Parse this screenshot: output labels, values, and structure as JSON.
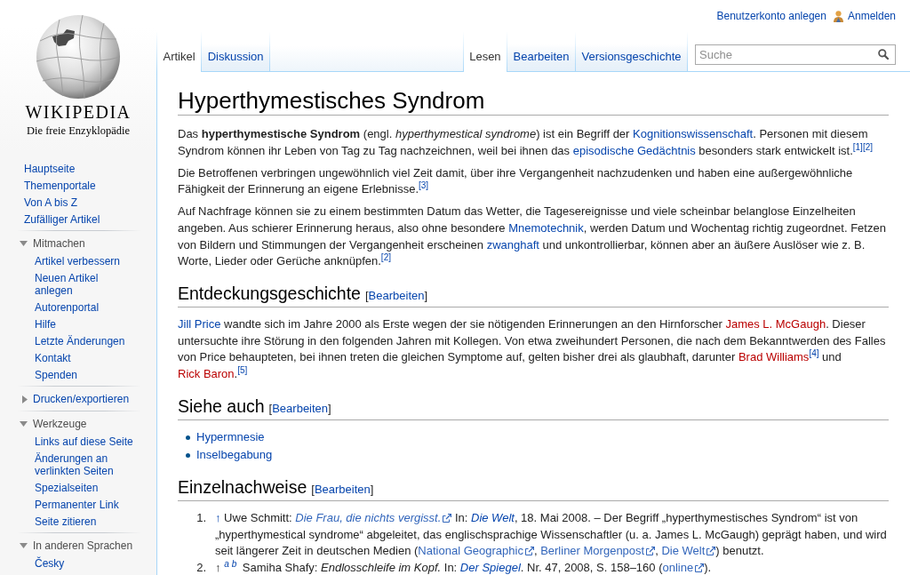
{
  "logo": {
    "wordmark": "WIKIPEDIA",
    "tagline": "Die freie Enzyklopädie"
  },
  "sidebar": {
    "main_links": [
      "Hauptseite",
      "Themenportale",
      "Von A bis Z",
      "Zufälliger Artikel"
    ],
    "portals": [
      {
        "title": "Mitmachen",
        "expanded": true,
        "items": [
          "Artikel verbessern",
          "Neuen Artikel anlegen",
          "Autorenportal",
          "Hilfe",
          "Letzte Änderungen",
          "Kontakt",
          "Spenden"
        ]
      },
      {
        "title": "Drucken/exportieren",
        "expanded": false
      },
      {
        "title": "Werkzeuge",
        "expanded": true,
        "items": [
          "Links auf diese Seite",
          "Änderungen an verlinkten Seiten",
          "Spezialseiten",
          "Permanenter Link",
          "Seite zitieren"
        ]
      },
      {
        "title": "In anderen Sprachen",
        "expanded": true,
        "items": [
          "Česky"
        ]
      }
    ]
  },
  "personal_links": {
    "create_account": "Benutzerkonto anlegen",
    "login": "Anmelden"
  },
  "namespace_tabs": [
    {
      "label": "Artikel",
      "selected": true
    },
    {
      "label": "Diskussion",
      "selected": false
    }
  ],
  "view_tabs": [
    {
      "label": "Lesen",
      "selected": true
    },
    {
      "label": "Bearbeiten",
      "selected": false
    },
    {
      "label": "Versionsgeschichte",
      "selected": false
    }
  ],
  "search": {
    "placeholder": "Suche"
  },
  "article": {
    "title": "Hyperthymestisches Syndrom",
    "intro": [
      {
        "segments": [
          {
            "kind": "text",
            "text": "Das **hyperthymestische Syndrom** (engl. *hyperthymestical syndrome*) ist ein Begriff der "
          },
          {
            "kind": "link",
            "text": "Kognitionswissenschaft"
          },
          {
            "kind": "text",
            "text": ". Personen mit diesem Syndrom können ihr Leben von Tag zu Tag nachzeichnen, weil bei ihnen das "
          },
          {
            "kind": "link",
            "text": "episodische Gedächtnis"
          },
          {
            "kind": "text",
            "text": " besonders stark entwickelt ist."
          },
          {
            "kind": "ref",
            "text": "[1]"
          },
          {
            "kind": "ref",
            "text": "[2]"
          }
        ]
      },
      {
        "segments": [
          {
            "kind": "text",
            "text": "Die Betroffenen verbringen ungewöhnlich viel Zeit damit, über ihre Vergangenheit nachzudenken und haben eine außergewöhnliche Fähigkeit der Erinnerung an eigene Erlebnisse."
          },
          {
            "kind": "ref",
            "text": "[3]"
          }
        ]
      },
      {
        "segments": [
          {
            "kind": "text",
            "text": "Auf Nachfrage können sie zu einem bestimmten Datum das Wetter, die Tagesereignisse und viele scheinbar belanglose Einzelheiten angeben. Aus schierer Erinnerung heraus, also ohne besondere "
          },
          {
            "kind": "link",
            "text": "Mnemotechnik"
          },
          {
            "kind": "text",
            "text": ", werden Datum und Wochentag richtig zugeordnet. Fetzen von Bildern und Stimmungen der Vergangenheit erscheinen "
          },
          {
            "kind": "link",
            "text": "zwanghaft"
          },
          {
            "kind": "text",
            "text": " und unkontrollierbar, können aber an äußere Auslöser wie z. B. Worte, Lieder oder Gerüche anknüpfen."
          },
          {
            "kind": "ref",
            "text": "[2]"
          }
        ]
      }
    ],
    "sections": [
      {
        "kind": "text",
        "title": "Entdeckungsgeschichte",
        "edit_link": {
          "open": "[",
          "label": "Bearbeiten",
          "close": "]"
        },
        "paragraphs": [
          {
            "segments": [
              {
                "kind": "link",
                "text": "Jill Price"
              },
              {
                "kind": "text",
                "text": " wandte sich im Jahre 2000 als Erste wegen der sie nötigenden Erinnerungen an den Hirnforscher "
              },
              {
                "kind": "redlink",
                "text": "James L. McGaugh"
              },
              {
                "kind": "text",
                "text": ". Dieser untersuchte ihre Störung in den folgenden Jahren mit Kollegen. Von etwa zweihundert Personen, die nach dem Bekanntwerden des Falles von Price behaupteten, bei ihnen treten die gleichen Symptome auf, gelten bisher drei als glaubhaft, darunter "
              },
              {
                "kind": "redlink",
                "text": "Brad Williams"
              },
              {
                "kind": "ref",
                "text": "[4]"
              },
              {
                "kind": "text",
                "text": " und "
              },
              {
                "kind": "redlink",
                "text": "Rick Baron"
              },
              {
                "kind": "text",
                "text": "."
              },
              {
                "kind": "ref",
                "text": "[5]"
              }
            ]
          }
        ]
      },
      {
        "kind": "links",
        "title": "Siehe auch",
        "edit_link": {
          "open": "[",
          "label": "Bearbeiten",
          "close": "]"
        },
        "items": [
          "Hypermnesie",
          "Inselbegabung"
        ]
      },
      {
        "kind": "references",
        "title": "Einzelnachweise",
        "edit_link": {
          "open": "[",
          "label": "Bearbeiten",
          "close": "]"
        },
        "items": [
          {
            "number": "1.",
            "segments": [
              {
                "kind": "backlink",
                "text": "↑"
              },
              {
                "kind": "text",
                "text": " Uwe Schmitt: "
              },
              {
                "kind": "extlink",
                "text": "Die Frau, die nichts vergisst.",
                "italic": true
              },
              {
                "kind": "text",
                "text": " In: "
              },
              {
                "kind": "link",
                "text": "Die Welt",
                "italic": true
              },
              {
                "kind": "text",
                "text": ", 18. Mai 2008. – Der Begriff „hyperthymestisches Syndrom“ ist von „hyperthymestical syndrome“ abgeleitet, das englischsprachige Wissenschaftler (u. a. James L. McGaugh) geprägt haben, und wird seit längerer Zeit in deutschen Medien ("
              },
              {
                "kind": "extlink",
                "text": "National Geographic"
              },
              {
                "kind": "text",
                "text": ", "
              },
              {
                "kind": "extlink",
                "text": "Berliner Morgenpost"
              },
              {
                "kind": "text",
                "text": ", "
              },
              {
                "kind": "extlink",
                "text": "Die Welt"
              },
              {
                "kind": "text",
                "text": ") benutzt."
              }
            ]
          },
          {
            "number": "2.",
            "segments": [
              {
                "kind": "text",
                "text": "↑ "
              },
              {
                "kind": "backref",
                "text": "a"
              },
              {
                "kind": "backref",
                "text": "b"
              },
              {
                "kind": "text",
                "text": " Samiha Shafy: *Endlosschleife im Kopf.* In: "
              },
              {
                "kind": "link",
                "text": "Der Spiegel",
                "italic": true
              },
              {
                "kind": "text",
                "text": ". Nr. 47, 2008, S. 158–160 ("
              },
              {
                "kind": "extlink",
                "text": "online"
              },
              {
                "kind": "text",
                "text": ")."
              }
            ]
          }
        ]
      }
    ]
  }
}
